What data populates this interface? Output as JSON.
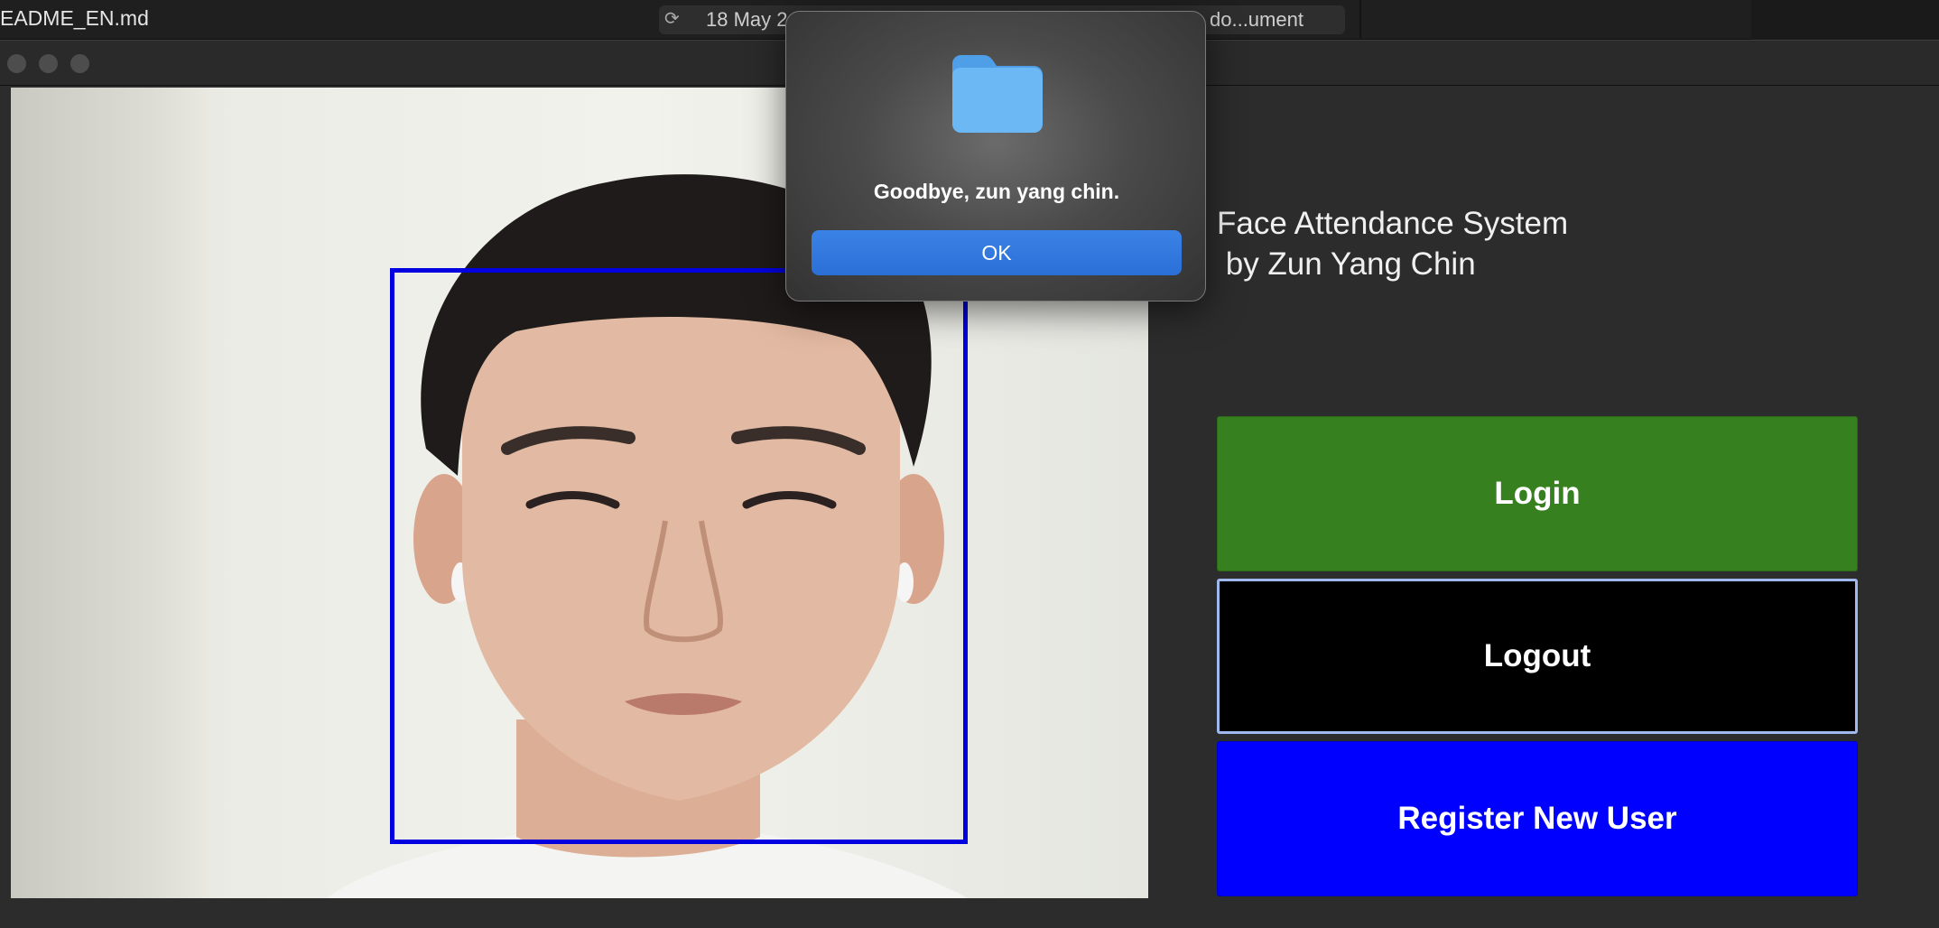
{
  "background_app": {
    "filename": "EADME_EN.md",
    "date_text": "18 May 2",
    "doc_text": "do...ument",
    "sync_icon": "sync-icon"
  },
  "window": {
    "traffic_lights": [
      "close-button",
      "minimize-button",
      "zoom-button"
    ]
  },
  "app": {
    "title": "Face Attendance System\n by Zun Yang Chin",
    "buttons": {
      "login": "Login",
      "logout": "Logout",
      "register": "Register New User"
    },
    "colors": {
      "login": "#37801f",
      "logout": "#000000",
      "register": "#0000ff",
      "face_box": "#0000e0"
    }
  },
  "dialog": {
    "icon": "folder-icon",
    "message": "Goodbye, zun yang chin.",
    "ok_label": "OK"
  }
}
